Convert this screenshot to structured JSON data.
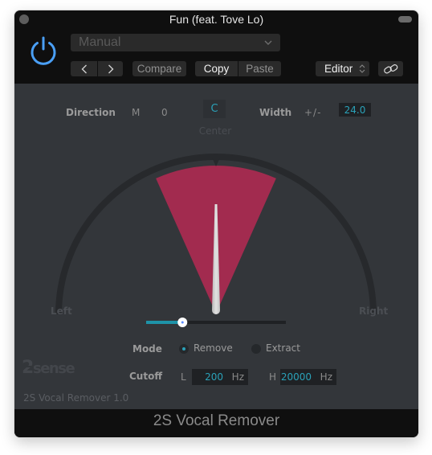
{
  "window": {
    "title": "Fun (feat. Tove Lo)"
  },
  "header": {
    "power_icon": "power-icon",
    "power_color": "#4a9ff5",
    "preset": {
      "value": "Manual",
      "icon": "chevron-down-icon"
    },
    "nav": {
      "prev_label": "‹",
      "next_label": "›"
    },
    "compare_label": "Compare",
    "copy_label": "Copy",
    "paste_label": "Paste",
    "view_select": {
      "value": "Editor",
      "icon": "up-down-chevron-icon"
    },
    "link_icon": "link-icon"
  },
  "plugin": {
    "direction": {
      "label": "Direction",
      "mode_label": "M",
      "value": "0",
      "center_button": "C",
      "center_caption": "Center"
    },
    "width": {
      "label": "Width",
      "plusminus": "+/-",
      "value": "24.0",
      "degrees": 24
    },
    "dial": {
      "left_label": "Left",
      "right_label": "Right",
      "direction_degrees": 0,
      "wedge_color": "#a22b4f",
      "track_color": "#27292c",
      "needle_color": "#d4d4d4"
    },
    "slider": {
      "fraction": 0.26,
      "fill_color": "#1e93a8"
    },
    "mode": {
      "label": "Mode",
      "options": [
        {
          "label": "Remove",
          "selected": true
        },
        {
          "label": "Extract",
          "selected": false
        }
      ]
    },
    "cutoff": {
      "label": "Cutoff",
      "low": {
        "prefix": "L",
        "value": "200",
        "unit": "Hz"
      },
      "high": {
        "prefix": "H",
        "value": "20000",
        "unit": "Hz"
      }
    },
    "brand": "2sense",
    "version_text": "2S Vocal Remover  1.0",
    "accent_color": "#2aa1b8"
  },
  "footer": {
    "title": "2S Vocal Remover"
  }
}
